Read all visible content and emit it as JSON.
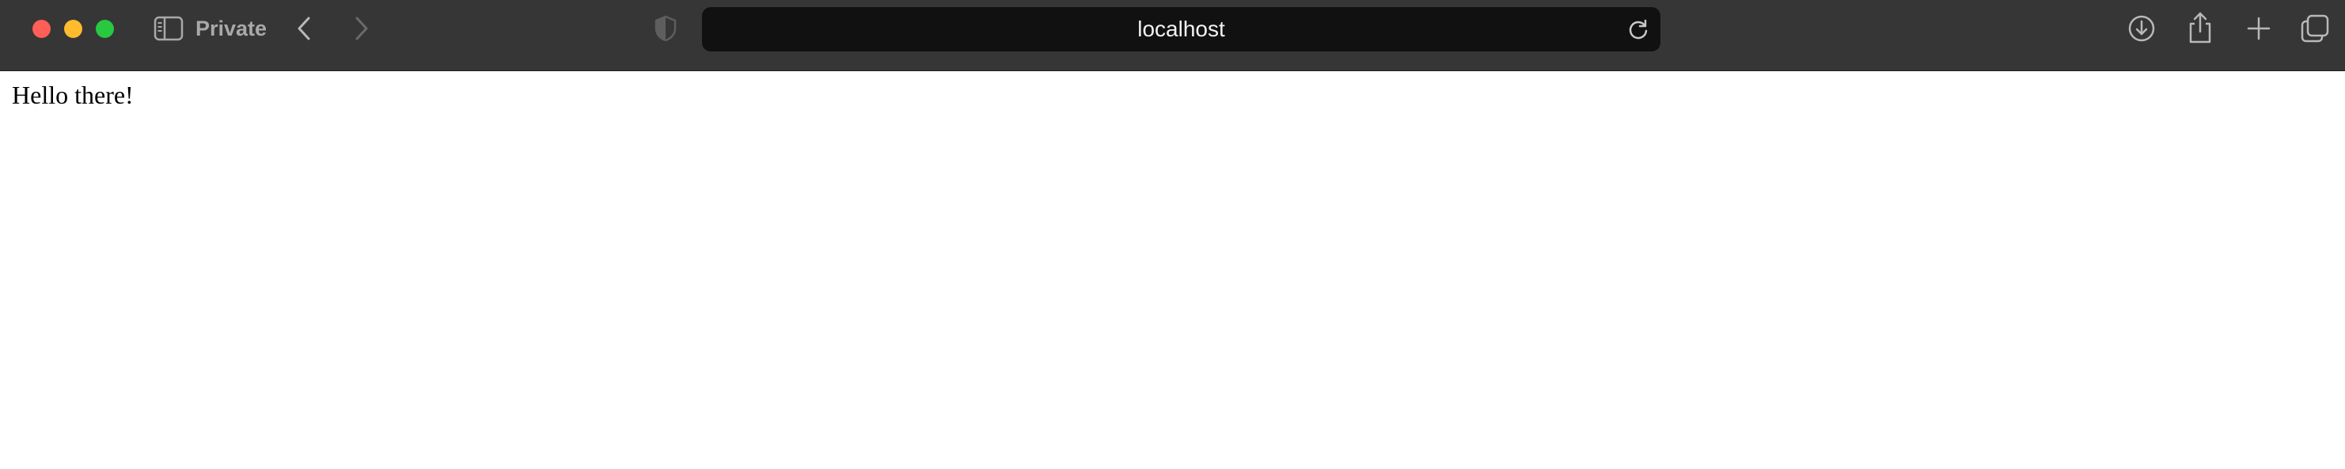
{
  "browser": {
    "mode_label": "Private",
    "address": "localhost",
    "icons": {
      "sidebar": "sidebar-icon",
      "back": "chevron-left-icon",
      "forward": "chevron-right-icon",
      "privacy": "shield-icon",
      "reload": "reload-icon",
      "download": "download-icon",
      "share": "share-icon",
      "new_tab": "plus-icon",
      "tabs": "tab-overview-icon"
    },
    "colors": {
      "toolbar": "#363636",
      "address_bar": "#111111",
      "close": "#ff5f57",
      "minimize": "#febc2e",
      "maximize": "#28c840"
    }
  },
  "page": {
    "text": "Hello there!"
  }
}
